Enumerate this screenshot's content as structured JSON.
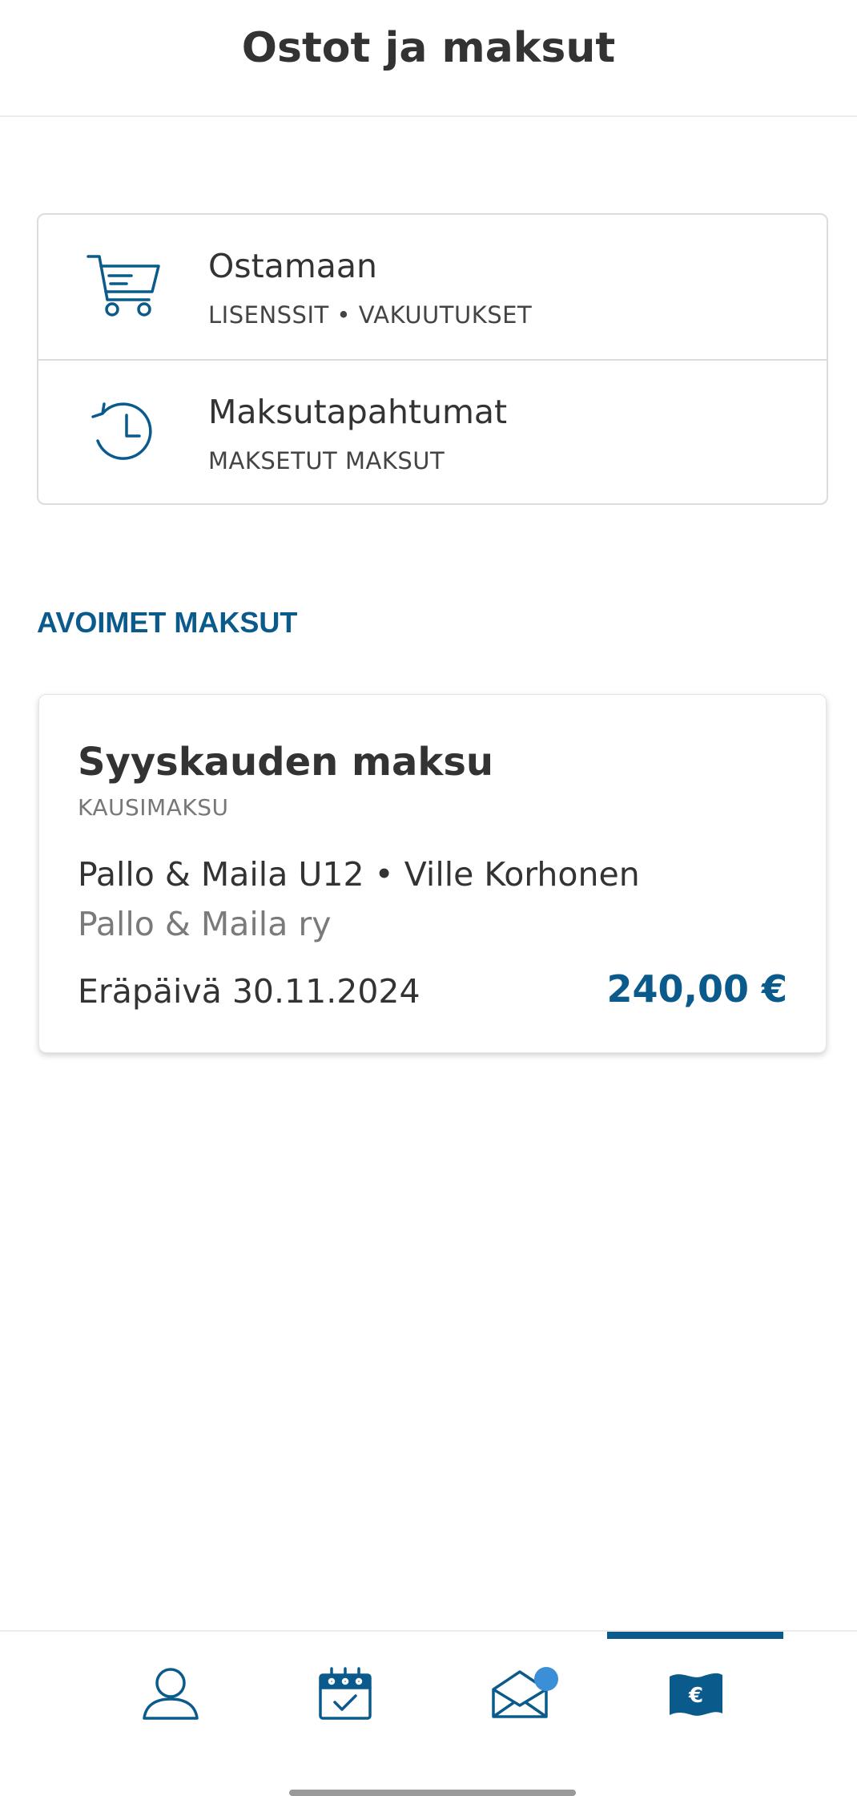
{
  "header": {
    "title": "Ostot ja maksut"
  },
  "menu": [
    {
      "title": "Ostamaan",
      "subtitle": "LISENSSIT • VAKUUTUKSET",
      "icon": "shopping-cart-icon"
    },
    {
      "title": "Maksutapahtumat",
      "subtitle": "MAKSETUT MAKSUT",
      "icon": "history-clock-icon"
    }
  ],
  "open_payments": {
    "section_label": "AVOIMET MAKSUT",
    "items": [
      {
        "title": "Syyskauden maksu",
        "type": "KAUSIMAKSU",
        "team_player": "Pallo & Maila U12 • Ville Korhonen",
        "organization": "Pallo & Maila ry",
        "due": "Eräpäivä 30.11.2024",
        "amount": "240,00 €"
      }
    ]
  },
  "bottom_nav": {
    "items": [
      {
        "icon": "profile-icon",
        "active": false
      },
      {
        "icon": "calendar-icon",
        "active": false
      },
      {
        "icon": "messages-icon",
        "active": false,
        "has_notification": true
      },
      {
        "icon": "payments-icon",
        "active": true,
        "glyph": "€"
      }
    ]
  },
  "colors": {
    "accent": "#0b5a8c",
    "notification": "#3b8fd6",
    "text": "#333333",
    "muted": "#7a7a7a"
  }
}
